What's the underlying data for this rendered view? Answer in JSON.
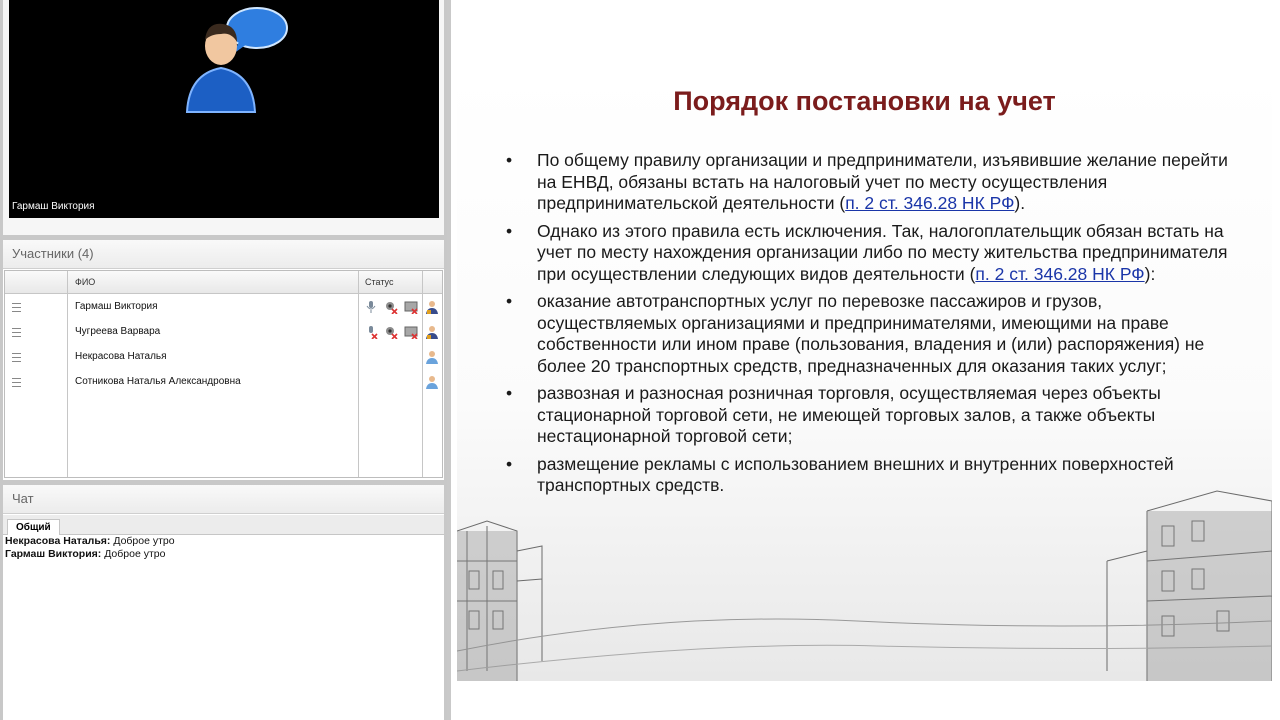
{
  "video": {
    "participant_name": "Гармаш Виктория"
  },
  "participants": {
    "title": "Участники (4)",
    "columns": {
      "fio": "ФИО",
      "status": "Статус"
    },
    "rows": [
      {
        "name": "Гармаш Виктория"
      },
      {
        "name": "Чугреева Варвара"
      },
      {
        "name": "Некрасова Наталья"
      },
      {
        "name": "Сотникова Наталья Александровна"
      }
    ]
  },
  "chat": {
    "title": "Чат",
    "tab": "Общий",
    "messages": [
      {
        "author": "Некрасова Наталья:",
        "text": "Доброе утро"
      },
      {
        "author": "Гармаш Виктория:",
        "text": "Доброе утро"
      }
    ]
  },
  "slide": {
    "title": "Порядок постановки на учет",
    "b1_text": "По общему правилу организации и предприниматели, изъявившие желание перейти на ЕНВД, обязаны встать на налоговый учет по месту осуществления предпринимательской деятельности (",
    "b1_link": "п. 2 ст. 346.28 НК РФ",
    "b1_end": ").",
    "b2_text": "Однако из этого правила есть исключения. Так, налогоплательщик обязан встать на учет по месту нахождения организации либо по месту жительства предпринимателя при осуществлении следующих видов деятельности (",
    "b2_link": "п. 2 ст. 346.28 НК РФ",
    "b2_end": "):",
    "b3_text": "оказание автотранспортных услуг по перевозке пассажиров и грузов, осуществляемых организациями и предпринимателями, имеющими на праве собственности или ином праве (пользования, владения и (или) распоряжения) не более 20 транспортных средств, предназначенных для оказания таких услуг;",
    "b4_text": "развозная и разносная розничная торговля, осуществляемая через объекты стационарной торговой сети, не имеющей торговых залов, а также объекты нестационарной торговой сети;",
    "b5_text": "размещение рекламы с использованием внешних и внутренних поверхностей транспортных средств."
  },
  "colors": {
    "title": "#7b1c1c",
    "link": "#1a35a8",
    "panel_bg": "#c8c8c8"
  }
}
